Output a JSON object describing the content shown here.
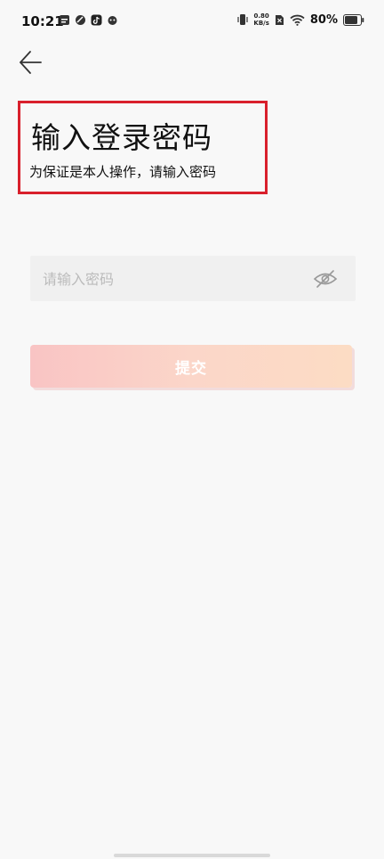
{
  "status_bar": {
    "time": "10:21",
    "net_speed_value": "0.80",
    "net_speed_unit": "KB/s",
    "battery_percent": "80%"
  },
  "header": {
    "title": "输入登录密码",
    "subtitle": "为保证是本人操作，请输入密码"
  },
  "form": {
    "password_placeholder": "请输入密码",
    "submit_label": "提交"
  },
  "colors": {
    "highlight_border": "#d9202c",
    "button_gradient_start": "#f9c4c4",
    "button_gradient_end": "#fcdcc4"
  },
  "icons": {
    "back": "arrow-left-icon",
    "password_visibility": "eye-slash-icon"
  }
}
